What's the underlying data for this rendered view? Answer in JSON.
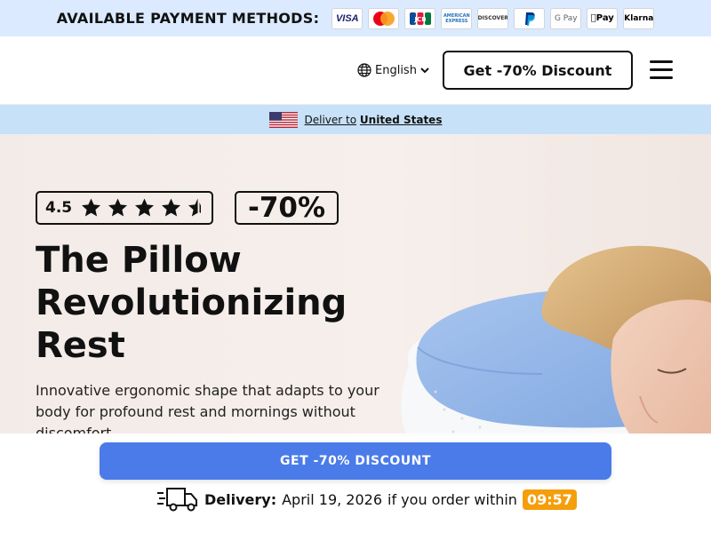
{
  "paybar": {
    "label": "AVAILABLE PAYMENT METHODS:",
    "methods": [
      {
        "name": "visa-icon",
        "text": "VISA"
      },
      {
        "name": "mastercard-icon",
        "text": ""
      },
      {
        "name": "jcb-icon",
        "text": "JCB"
      },
      {
        "name": "amex-icon",
        "text": "AMERICAN EXPRESS"
      },
      {
        "name": "discover-icon",
        "text": "DISCOVER"
      },
      {
        "name": "paypal-icon",
        "text": "P"
      },
      {
        "name": "google-pay-icon",
        "text": "G Pay"
      },
      {
        "name": "apple-pay-icon",
        "text": "Pay"
      },
      {
        "name": "klarna-icon",
        "text": "Klarna"
      }
    ]
  },
  "header": {
    "language": "English",
    "cta_label": "Get -70% Discount"
  },
  "deliver": {
    "prefix": "Deliver to",
    "country": "United States"
  },
  "hero": {
    "rating": "4.5",
    "stars": 4.5,
    "discount": "-70%",
    "title": "The Pillow Revolutionizing Rest",
    "subtitle": "Innovative ergonomic shape that adapts to your body for profound rest and mornings without discomfort"
  },
  "sticky": {
    "cta_label": "GET -70% DISCOUNT",
    "delivery_label": "Delivery:",
    "delivery_date": "April 19, 2026",
    "delivery_suffix": "if you order within",
    "timer": "09:57"
  },
  "colors": {
    "paybar_bg": "#dbeafe",
    "deliver_bg": "#c7e1f8",
    "cta_blue": "#4a7be9",
    "timer_orange": "#f59e0b"
  }
}
